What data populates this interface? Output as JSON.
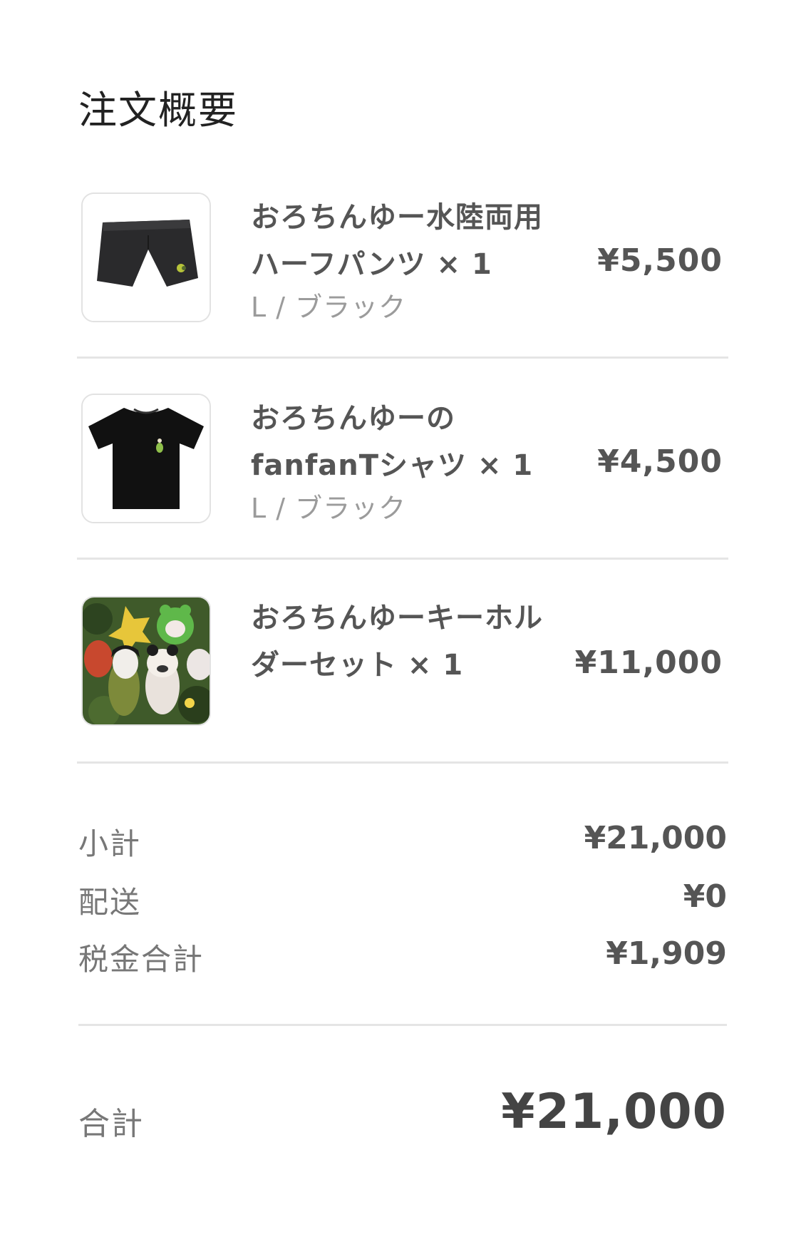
{
  "header": {
    "title": "注文概要"
  },
  "items": [
    {
      "name": "おろちんゆー水陸両用ハーフパンツ × 1",
      "variant": "L / ブラック",
      "price": "¥5,500",
      "image": "black-shorts"
    },
    {
      "name": "おろちんゆーのfanfanTシャツ × 1",
      "variant": "L / ブラック",
      "price": "¥4,500",
      "image": "black-tshirt"
    },
    {
      "name": "おろちんゆーキーホルダーセット × 1",
      "variant": "",
      "price": "¥11,000",
      "image": "plush-keychain-set"
    }
  ],
  "summary": {
    "subtotal_label": "小計",
    "subtotal_value": "¥21,000",
    "shipping_label": "配送",
    "shipping_value": "¥0",
    "tax_label": "税金合計",
    "tax_value": "¥1,909"
  },
  "total": {
    "label": "合計",
    "value": "¥21,000"
  }
}
